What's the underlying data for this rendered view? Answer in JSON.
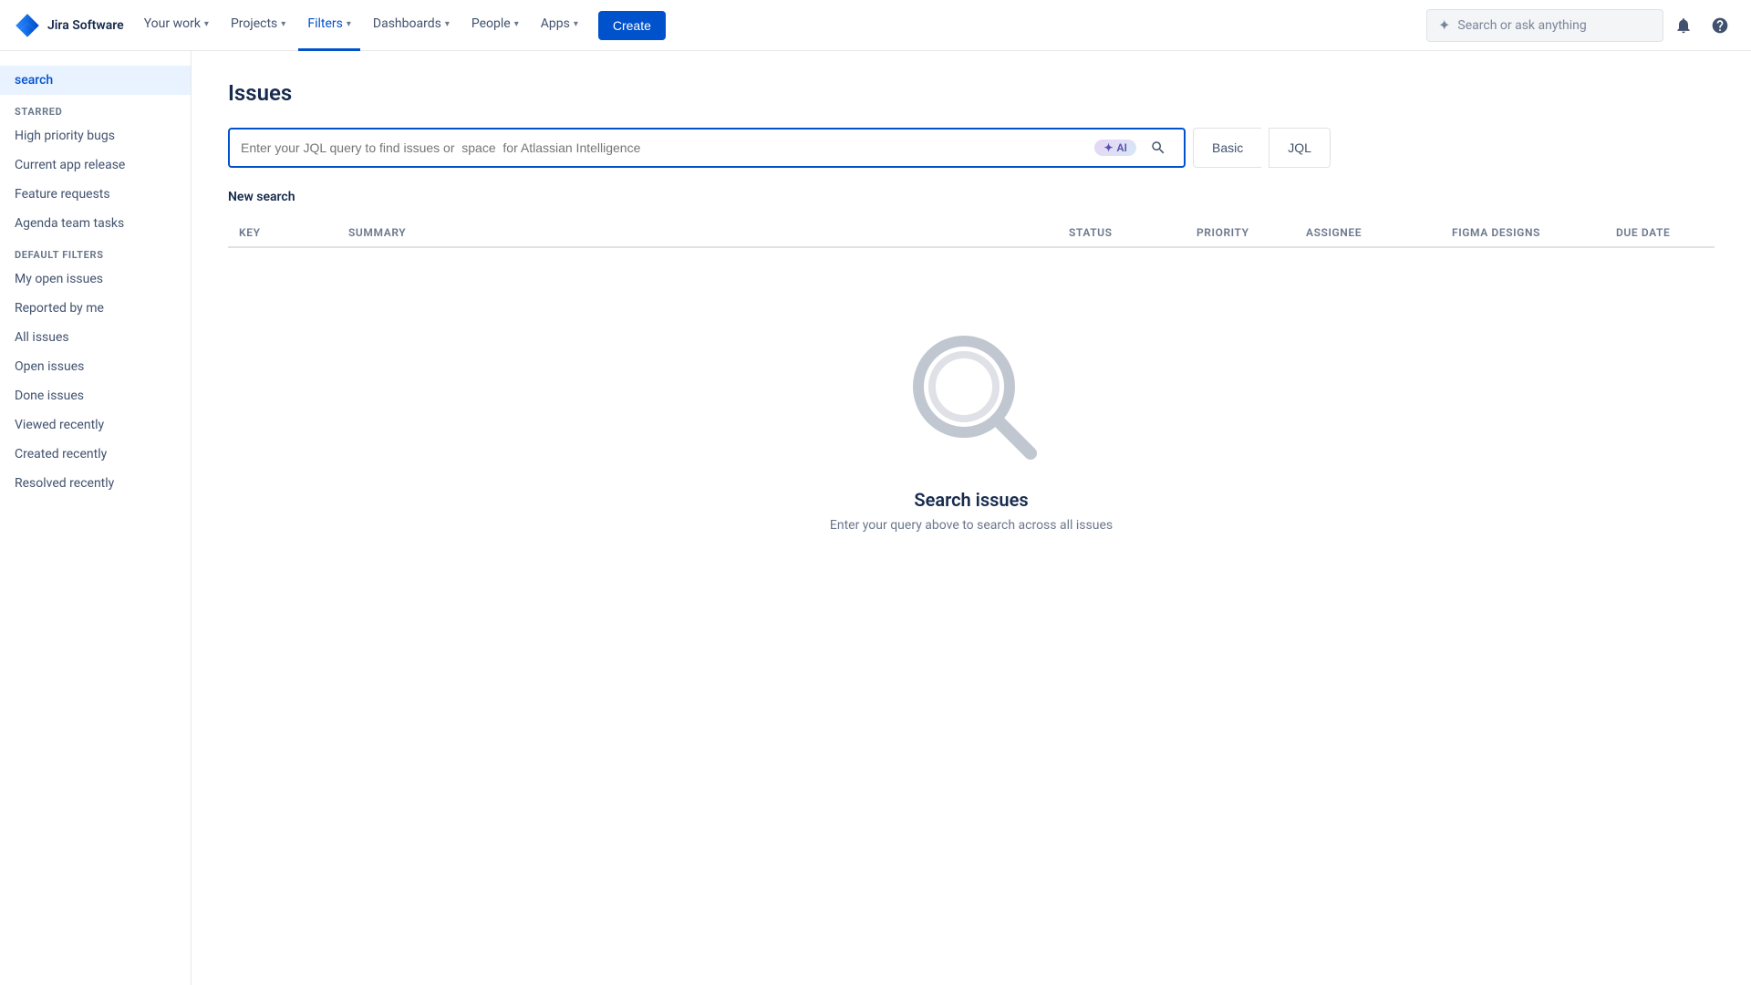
{
  "app": {
    "name": "Jira Software"
  },
  "topnav": {
    "logo_text": "Jira Software",
    "items": [
      {
        "label": "Your work",
        "has_chevron": true,
        "active": false
      },
      {
        "label": "Projects",
        "has_chevron": true,
        "active": false
      },
      {
        "label": "Filters",
        "has_chevron": true,
        "active": true
      },
      {
        "label": "Dashboards",
        "has_chevron": true,
        "active": false
      },
      {
        "label": "People",
        "has_chevron": true,
        "active": false
      },
      {
        "label": "Apps",
        "has_chevron": true,
        "active": false
      }
    ],
    "create_label": "Create",
    "search_placeholder": "Search or ask anything"
  },
  "sidebar": {
    "search_item": "search",
    "starred_section": "STARRED",
    "starred_items": [
      "High priority bugs",
      "Current app release",
      "Feature requests",
      "Agenda team tasks"
    ],
    "default_section": "DEFAULT FILTERS",
    "default_items": [
      "My open issues",
      "Reported by me",
      "All issues",
      "Open issues",
      "Done issues",
      "Viewed recently",
      "Created recently",
      "Resolved recently"
    ]
  },
  "main": {
    "page_title": "Issues",
    "jql_placeholder": "Enter your JQL query to find issues or  space  for Atlassian Intelligence",
    "ai_label": "AI",
    "mode_basic": "Basic",
    "mode_jql": "JQL",
    "new_search_label": "New search",
    "table_columns": [
      {
        "key": "key",
        "label": "Key"
      },
      {
        "key": "summary",
        "label": "Summary"
      },
      {
        "key": "status",
        "label": "Status"
      },
      {
        "key": "priority",
        "label": "Priority"
      },
      {
        "key": "assignee",
        "label": "Assignee"
      },
      {
        "key": "figma",
        "label": "Figma Designs"
      },
      {
        "key": "due_date",
        "label": "Due date"
      }
    ],
    "empty_state": {
      "title": "Search issues",
      "subtitle": "Enter your query above to search across all issues"
    }
  }
}
